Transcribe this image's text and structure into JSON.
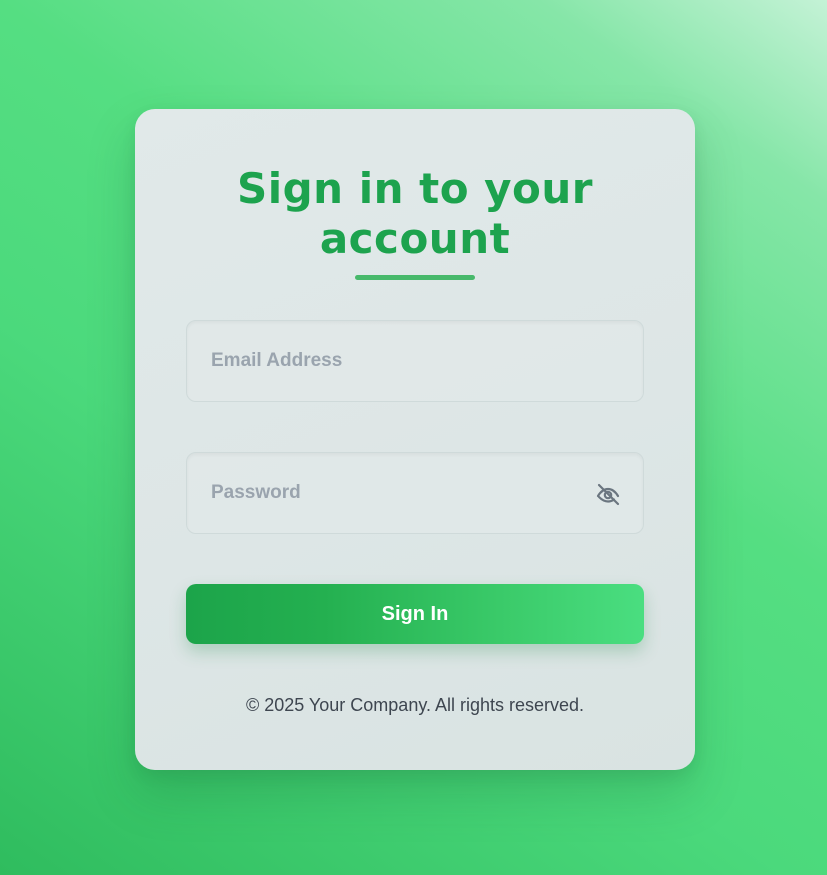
{
  "login": {
    "title_line1": "Sign in to your",
    "title_line2": "account",
    "email": {
      "placeholder": "Email Address",
      "value": ""
    },
    "password": {
      "placeholder": "Password",
      "value": ""
    },
    "toggle_icon": "eye-off-icon",
    "submit_label": "Sign In",
    "footer": "© 2025 Your Company. All rights reserved."
  },
  "colors": {
    "accent": "#1da34e",
    "button_start": "#1ca44a",
    "button_end": "#4ade80",
    "background": "#4bd97c"
  }
}
